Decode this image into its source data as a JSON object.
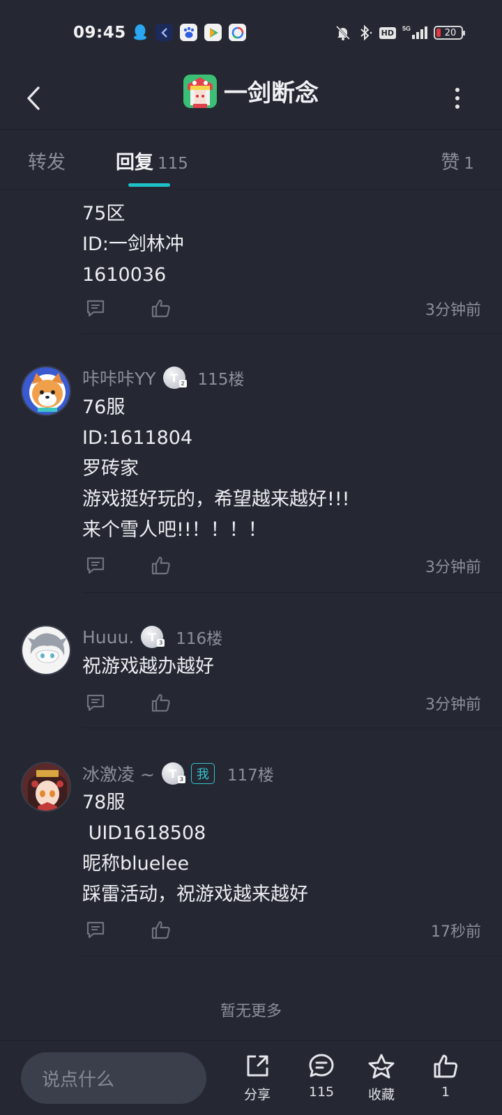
{
  "status_bar": {
    "time": "09:45",
    "battery": "20",
    "icons": [
      "qq-icon",
      "app-icon",
      "baidu-icon",
      "video-icon",
      "browser-icon",
      "mute-icon",
      "bluetooth-icon",
      "hd-icon",
      "5g-signal-icon",
      "battery-icon"
    ],
    "hd_label": "HD"
  },
  "header": {
    "title": "一剑断念"
  },
  "tabs": {
    "repost": "转发",
    "reply": "回复",
    "reply_count": "115",
    "like": "赞",
    "like_count": "1"
  },
  "comments": [
    {
      "partial": true,
      "lines": [
        "75区",
        "ID:一剑林冲",
        "1610036"
      ],
      "time": "3分钟前"
    },
    {
      "name": "咔咔咔YY",
      "floor": "115楼",
      "lines": [
        "76服",
        "ID:1611804",
        "罗砖家",
        "游戏挺好玩的，希望越来越好!!!",
        "来个雪人吧!!！！！！"
      ],
      "time": "3分钟前"
    },
    {
      "name": "Huuu.",
      "floor": "116楼",
      "lines": [
        "祝游戏越办越好"
      ],
      "time": "3分钟前"
    },
    {
      "name": "冰激凌 ~",
      "me_tag": "我",
      "floor": "117楼",
      "lines": [
        "78服",
        " UID1618508",
        "昵称bluelee",
        "踩雷活动，祝游戏越来越好"
      ],
      "time": "17秒前"
    }
  ],
  "footer_note": "暂无更多",
  "bottom_bar": {
    "input_placeholder": "说点什么",
    "share_label": "分享",
    "comment_count": "115",
    "favorite_label": "收藏",
    "like_count": "1"
  },
  "colors": {
    "background": "#252833",
    "accent": "#1ec2c9",
    "muted_text": "#8c909a",
    "primary_text": "#eceef1"
  }
}
